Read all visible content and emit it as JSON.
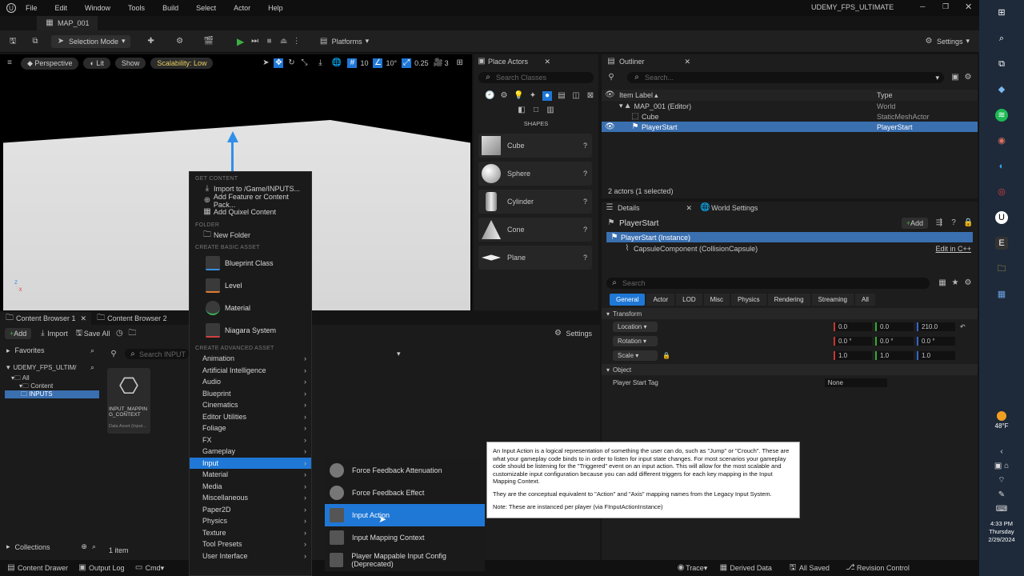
{
  "window": {
    "project": "UDEMY_FPS_ULTIMATE",
    "map_tab": "MAP_001",
    "menu": [
      "File",
      "Edit",
      "Window",
      "Tools",
      "Build",
      "Select",
      "Actor",
      "Help"
    ]
  },
  "toolbar": {
    "selection_mode": "Selection Mode",
    "platforms": "Platforms",
    "settings": "Settings"
  },
  "viewport": {
    "perspective": "Perspective",
    "lit": "Lit",
    "show": "Show",
    "scalability": "Scalability: Low",
    "grid": "10",
    "angle": "10°",
    "scale": "0.25",
    "camera": "3"
  },
  "place_actors": {
    "title": "Place Actors",
    "search": "Search Classes",
    "section": "SHAPES",
    "shapes": [
      "Cube",
      "Sphere",
      "Cylinder",
      "Cone",
      "Plane"
    ]
  },
  "outliner": {
    "title": "Outliner",
    "search": "Search...",
    "col_label": "Item Label",
    "col_type": "Type",
    "rows": [
      {
        "label": "MAP_001 (Editor)",
        "type": "World"
      },
      {
        "label": "Cube",
        "type": "StaticMeshActor"
      },
      {
        "label": "PlayerStart",
        "type": "PlayerStart"
      }
    ],
    "footer": "2 actors (1 selected)"
  },
  "details": {
    "title": "Details",
    "world_settings": "World Settings",
    "actor": "PlayerStart",
    "add": "Add",
    "instance": "PlayerStart (Instance)",
    "component": "CapsuleComponent (CollisionCapsule)",
    "edit_cpp": "Edit in C++",
    "search": "Search",
    "filters": [
      "General",
      "Actor",
      "LOD",
      "Misc",
      "Physics",
      "Rendering",
      "Streaming",
      "All"
    ],
    "transform": "Transform",
    "location": {
      "label": "Location",
      "x": "0.0",
      "y": "0.0",
      "z": "210.0"
    },
    "rotation": {
      "label": "Rotation",
      "x": "0.0 °",
      "y": "0.0 °",
      "z": "0.0 °"
    },
    "scale": {
      "label": "Scale",
      "x": "1.0",
      "y": "1.0",
      "z": "1.0"
    },
    "object": "Object",
    "tag_label": "Player Start Tag",
    "tag_value": "None"
  },
  "content_browser": {
    "tab1": "Content Browser 1",
    "tab2": "Content Browser 2",
    "add": "Add",
    "import": "Import",
    "save_all": "Save All",
    "settings": "Settings",
    "favorites": "Favorites",
    "project": "UDEMY_FPS_ULTIM/",
    "tree": [
      "All",
      "Content",
      "INPUTS"
    ],
    "search": "Search INPUT",
    "asset": "INPUT_MAPPING_CONTEXT",
    "asset_type": "Data Asset (Input...",
    "count": "1 item",
    "collections": "Collections"
  },
  "status": {
    "drawer": "Content Drawer",
    "output": "Output Log",
    "cmd": "Cmd",
    "trace": "Trace",
    "derived": "Derived Data",
    "saved": "All Saved",
    "revision": "Revision Control"
  },
  "context_menu": {
    "get_content": "GET CONTENT",
    "import": "Import to /Game/INPUTS...",
    "add_feature": "Add Feature or Content Pack...",
    "add_quixel": "Add Quixel Content",
    "folder": "FOLDER",
    "new_folder": "New Folder",
    "basic": "CREATE BASIC ASSET",
    "basic_items": [
      "Blueprint Class",
      "Level",
      "Material",
      "Niagara System"
    ],
    "advanced": "CREATE ADVANCED ASSET",
    "advanced_items": [
      "Animation",
      "Artificial Intelligence",
      "Audio",
      "Blueprint",
      "Cinematics",
      "Editor Utilities",
      "Foliage",
      "FX",
      "Gameplay",
      "Input",
      "Material",
      "Media",
      "Miscellaneous",
      "Paper2D",
      "Physics",
      "Texture",
      "Tool Presets",
      "User Interface"
    ]
  },
  "input_submenu": [
    "Force Feedback Attenuation",
    "Force Feedback Effect",
    "Input Action",
    "Input Mapping Context",
    "Player Mappable Input Config (Deprecated)"
  ],
  "tooltip": {
    "p1": "An Input Action is a logical representation of something the user can do, such as \"Jump\" or \"Crouch\". These are what your gameplay code binds to in order to listen for input state changes. For most scenarios your gameplay code should be listening for the \"Triggered\" event on an input action. This will allow for the most scalable and customizable input configuration because you can add different triggers for each key mapping in the Input Mapping Context.",
    "p2": "They are the conceptual equivalent to \"Action\" and \"Axis\" mapping names from the Legacy Input System.",
    "p3": "Note: These are instanced per player (via FInputActionInstance)"
  },
  "taskbar": {
    "weather": "48°F",
    "time": "4:33 PM",
    "day": "Thursday",
    "date": "2/29/2024"
  },
  "colors": {
    "accent": "#1f78d6",
    "selected_row": "#3a6fb0",
    "play": "#3cb043"
  }
}
